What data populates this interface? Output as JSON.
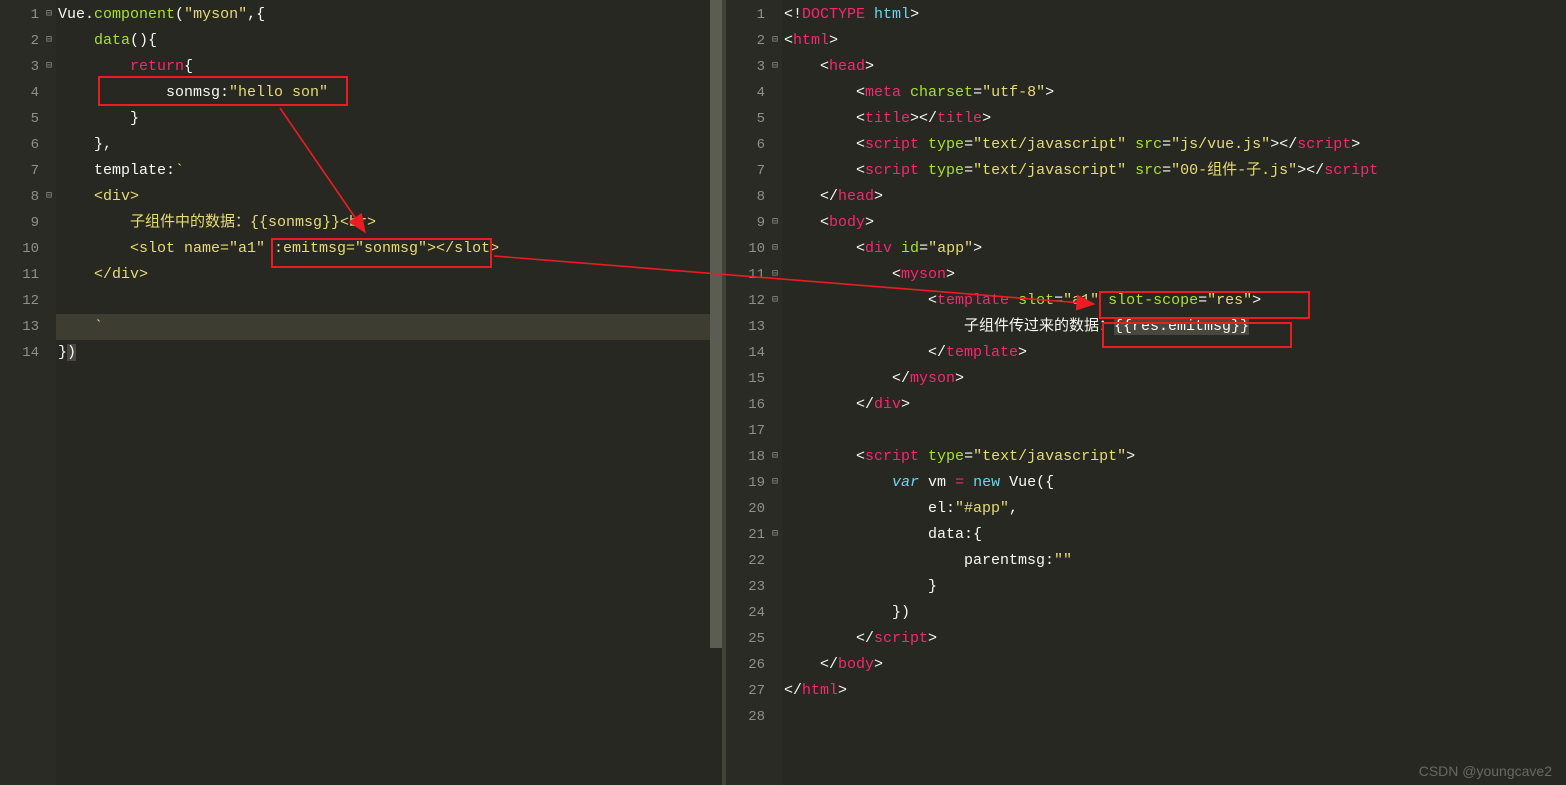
{
  "watermark": "CSDN @youngcave2",
  "left": {
    "lines": [
      "1",
      "2",
      "3",
      "4",
      "5",
      "6",
      "7",
      "8",
      "9",
      "10",
      "11",
      "12",
      "13",
      "14"
    ],
    "fold": [
      "⊟",
      "⊟",
      "⊟",
      "",
      "",
      "",
      "",
      "⊟",
      "",
      "",
      "",
      "",
      "",
      ""
    ],
    "code": {
      "l1": {
        "a": "Vue",
        "b": ".",
        "c": "component",
        "d": "(",
        "e": "\"myson\"",
        "f": ",{"
      },
      "l2": {
        "a": "    ",
        "b": "data",
        "c": "(){"
      },
      "l3": {
        "a": "        ",
        "b": "return",
        "c": "{"
      },
      "l4": {
        "a": "            sonmsg:",
        "b": "\"hello son\""
      },
      "l5": {
        "a": "        }"
      },
      "l6": {
        "a": "    },"
      },
      "l7": {
        "a": "    template:",
        "b": "`"
      },
      "l8": {
        "a": "    <div>"
      },
      "l9": {
        "a": "        子组件中的数据：{{sonmsg}}<br>"
      },
      "l10": {
        "a": "        <slot name=\"a1\" :emitmsg=\"sonmsg\"></slot>"
      },
      "l11": {
        "a": "    </div>"
      },
      "l12": {
        "a": ""
      },
      "l13": {
        "a": "    `"
      },
      "l14": {
        "a": "}",
        "b": ")"
      }
    }
  },
  "right": {
    "lines": [
      "1",
      "2",
      "3",
      "4",
      "5",
      "6",
      "7",
      "8",
      "9",
      "10",
      "11",
      "12",
      "13",
      "14",
      "15",
      "16",
      "17",
      "18",
      "19",
      "20",
      "21",
      "22",
      "23",
      "24",
      "25",
      "26",
      "27",
      "28"
    ],
    "fold": [
      "",
      "⊟",
      "⊟",
      "",
      "",
      "",
      "",
      "",
      "⊟",
      "⊟",
      "⊟",
      "⊟",
      "",
      "",
      "",
      "",
      "",
      "⊟",
      "⊟",
      "",
      "⊟",
      "",
      "",
      "",
      "",
      "",
      "",
      ""
    ],
    "code": {
      "r1": {
        "a": "<!",
        "b": "DOCTYPE",
        "c": " ",
        "d": "html",
        "e": ">"
      },
      "r2": {
        "a": "<",
        "b": "html",
        "c": ">"
      },
      "r3": {
        "a": "    <",
        "b": "head",
        "c": ">"
      },
      "r4": {
        "a": "        <",
        "b": "meta",
        "c": " ",
        "d": "charset",
        "e": "=",
        "f": "\"utf-8\"",
        "g": ">"
      },
      "r5": {
        "a": "        <",
        "b": "title",
        "c": "></",
        "d": "title",
        "e": ">"
      },
      "r6": {
        "a": "        <",
        "b": "script",
        "c": " ",
        "d": "type",
        "e": "=",
        "f": "\"text/javascript\"",
        "g": " ",
        "h": "src",
        "i": "=",
        "j": "\"js/vue.js\"",
        "k": "></",
        "l": "script",
        "m": ">"
      },
      "r7": {
        "a": "        <",
        "b": "script",
        "c": " ",
        "d": "type",
        "e": "=",
        "f": "\"text/javascript\"",
        "g": " ",
        "h": "src",
        "i": "=",
        "j": "\"00-组件-子.js\"",
        "k": "></",
        "l": "script"
      },
      "r8": {
        "a": "    </",
        "b": "head",
        "c": ">"
      },
      "r9": {
        "a": "    <",
        "b": "body",
        "c": ">"
      },
      "r10": {
        "a": "        <",
        "b": "div",
        "c": " ",
        "d": "id",
        "e": "=",
        "f": "\"app\"",
        "g": ">"
      },
      "r11": {
        "a": "            <",
        "b": "myson",
        "c": ">"
      },
      "r12": {
        "a": "                <",
        "b": "template",
        "c": " ",
        "d": "slot",
        "e": "=",
        "f": "\"a1\"",
        "g": " ",
        "h": "slot-scope",
        "i": "=",
        "j": "\"res\"",
        "k": ">"
      },
      "r13": {
        "a": "                    子组件传过来的数据：",
        "b": "{{res.emitmsg}}"
      },
      "r14": {
        "a": "                </",
        "b": "template",
        "c": ">"
      },
      "r15": {
        "a": "            </",
        "b": "myson",
        "c": ">"
      },
      "r16": {
        "a": "        </",
        "b": "div",
        "c": ">"
      },
      "r17": {
        "a": ""
      },
      "r18": {
        "a": "        <",
        "b": "script",
        "c": " ",
        "d": "type",
        "e": "=",
        "f": "\"text/javascript\"",
        "g": ">"
      },
      "r19": {
        "a": "            ",
        "b": "var",
        "c": " vm ",
        "d": "=",
        "e": " ",
        "f": "new",
        "g": " ",
        "h": "Vue",
        "i": "({"
      },
      "r20": {
        "a": "                el:",
        "b": "\"#app\"",
        "c": ","
      },
      "r21": {
        "a": "                data:{"
      },
      "r22": {
        "a": "                    parentmsg:",
        "b": "\"\""
      },
      "r23": {
        "a": "                }"
      },
      "r24": {
        "a": "            })"
      },
      "r25": {
        "a": "        </",
        "b": "script",
        "c": ">"
      },
      "r26": {
        "a": "    </",
        "b": "body",
        "c": ">"
      },
      "r27": {
        "a": "</",
        "b": "html",
        "c": ">"
      },
      "r28": {
        "a": ""
      }
    }
  }
}
